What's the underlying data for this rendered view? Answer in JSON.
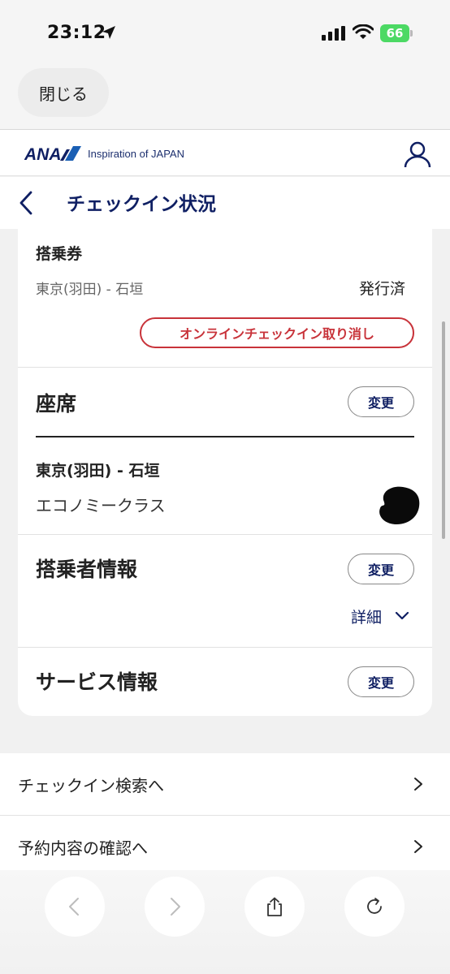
{
  "status_bar": {
    "time": "23:12",
    "battery": "66"
  },
  "close_button": {
    "label": "閉じる"
  },
  "header": {
    "logo_text": "ANA",
    "tagline": "Inspiration of JAPAN"
  },
  "title_bar": {
    "title": "チェックイン状況"
  },
  "boarding_pass": {
    "title": "搭乗券",
    "route": "東京(羽田) - 石垣",
    "status": "発行済",
    "cancel_label": "オンラインチェックイン取り消し"
  },
  "seat": {
    "title": "座席",
    "change_label": "変更",
    "route": "東京(羽田) - 石垣",
    "cabin": "エコノミークラス"
  },
  "passenger": {
    "title": "搭乗者情報",
    "change_label": "変更",
    "details_label": "詳細"
  },
  "service": {
    "title": "サービス情報",
    "change_label": "変更"
  },
  "links": [
    {
      "label": "チェックイン検索へ"
    },
    {
      "label": "予約内容の確認へ"
    }
  ],
  "toolbar": {
    "icons": [
      "back-icon",
      "forward-icon",
      "share-icon",
      "reload-icon"
    ]
  },
  "colors": {
    "brand_navy": "#0f1f63",
    "cancel_red": "#c8333a",
    "battery_green": "#4cd964"
  }
}
